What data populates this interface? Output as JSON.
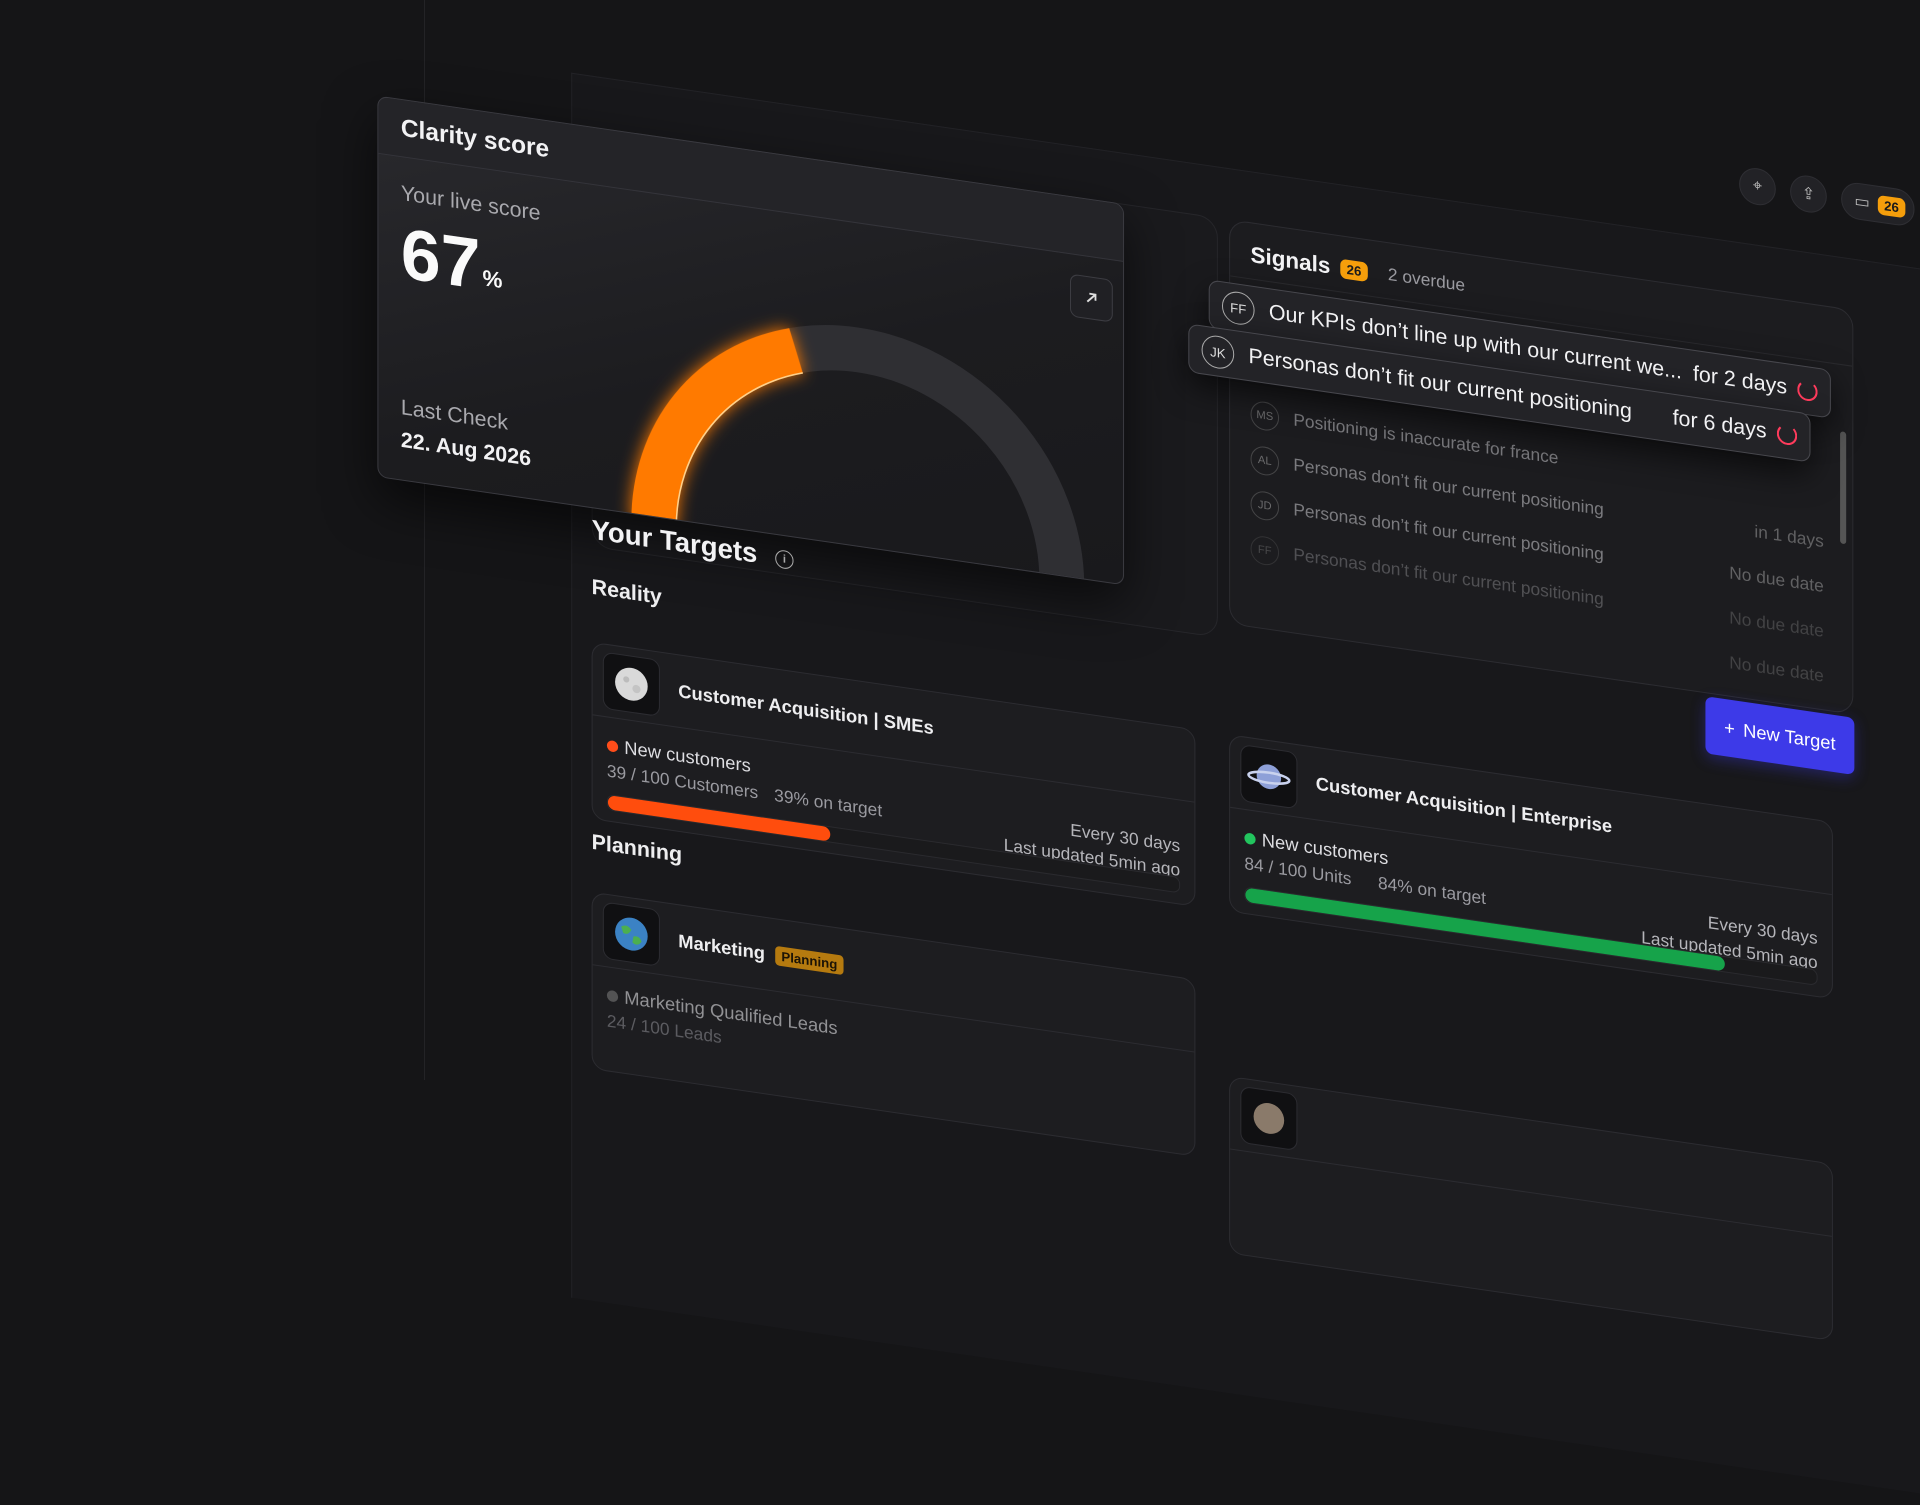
{
  "toolbar": {
    "comments_count": "26"
  },
  "clarity": {
    "title": "Clarity score",
    "live_label": "Your live score",
    "score": "67",
    "score_unit": "%",
    "score_value": 67,
    "last_check_label": "Last Check",
    "last_check_date": "22. Aug 2026"
  },
  "targets": {
    "title": "Your Targets",
    "new_button": "New Target",
    "reality_label": "Reality",
    "planning_label": "Planning",
    "cards": [
      {
        "name": "Customer Acquisition | SMEs",
        "metric": "New customers",
        "progress": "39 / 100 Customers",
        "pct_text": "39% on target",
        "pct": 0.39,
        "frequency": "Every 30 days",
        "updated": "Last updated 5min ago",
        "status_color": "#ff4d1a",
        "bar_color": "#ff4d0d"
      },
      {
        "name": "Customer Acquisition | Enterprise",
        "metric": "New customers",
        "progress": "84 / 100 Units",
        "pct_text": "84% on target",
        "pct": 0.84,
        "frequency": "Every 30 days",
        "updated": "Last updated 5min ago",
        "status_color": "#22c55e",
        "bar_color": "#16a34a"
      },
      {
        "name": "Marketing",
        "badge": "Planning",
        "metric": "Marketing Qualified Leads",
        "progress": "24 / 100 Leads",
        "status_color": "#777777"
      }
    ]
  },
  "signals": {
    "title": "Signals",
    "count": "26",
    "overdue": "2 overdue",
    "floating": [
      {
        "initials": "FF",
        "text": "Our KPIs don’t line up with our current we...",
        "due": "for 2 days"
      },
      {
        "initials": "JK",
        "text": "Personas don’t fit our current positioning",
        "due": "for 6 days"
      }
    ],
    "items": [
      {
        "initials": "MS",
        "text": "Positioning is inaccurate for france",
        "due": ""
      },
      {
        "initials": "AL",
        "text": "Personas don’t fit our current positioning",
        "due": "in 1 days"
      },
      {
        "initials": "JD",
        "text": "Personas don’t fit our current positioning",
        "due": "No due date"
      },
      {
        "initials": "FF",
        "text": "Personas don’t fit our current positioning",
        "due": "No due date"
      },
      {
        "initials": "",
        "text": "",
        "due": "No due date"
      }
    ]
  },
  "colors": {
    "accent": "#3d3ae8",
    "gauge": "#ff7a00",
    "overdue": "#ff3b5c"
  }
}
